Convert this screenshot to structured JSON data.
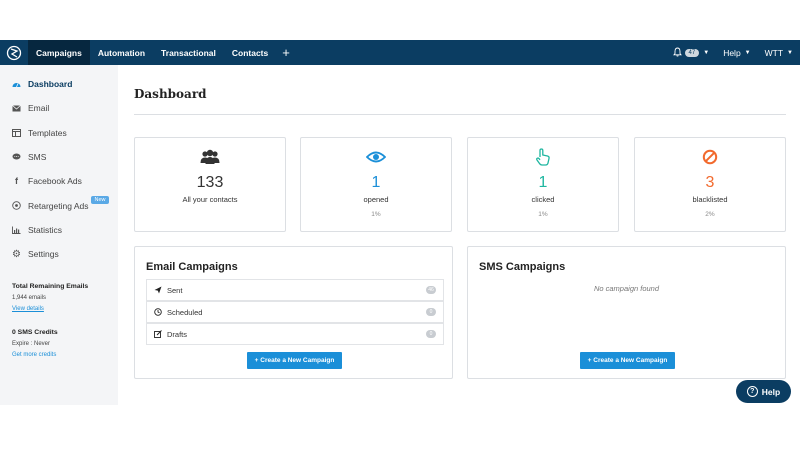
{
  "topnav": {
    "items": [
      "Campaigns",
      "Automation",
      "Transactional",
      "Contacts"
    ],
    "plus_label": "+",
    "notification_count": "47",
    "help_label": "Help",
    "account_label": "WTT"
  },
  "sidebar": {
    "items": [
      {
        "label": "Dashboard",
        "icon": "dashboard-icon"
      },
      {
        "label": "Email",
        "icon": "envelope-icon"
      },
      {
        "label": "Templates",
        "icon": "template-icon"
      },
      {
        "label": "SMS",
        "icon": "sms-bubble-icon"
      },
      {
        "label": "Facebook Ads",
        "icon": "facebook-icon"
      },
      {
        "label": "Retargeting Ads",
        "icon": "target-icon",
        "tag": "New"
      },
      {
        "label": "Statistics",
        "icon": "bar-chart-icon"
      },
      {
        "label": "Settings",
        "icon": "gear-icon"
      }
    ],
    "emails_block": {
      "title": "Total Remaining Emails",
      "count": "1,944 emails",
      "link": "View details"
    },
    "sms_block": {
      "title": "0 SMS Credits",
      "expire": "Expire : Never",
      "link": "Get more credits"
    }
  },
  "main": {
    "title": "Dashboard",
    "stats": [
      {
        "value": "133",
        "label": "All your contacts",
        "pct": "",
        "icon": "users-icon",
        "color": "#333333"
      },
      {
        "value": "1",
        "label": "opened",
        "pct": "1%",
        "icon": "eye-icon",
        "color": "#1b8fd8"
      },
      {
        "value": "1",
        "label": "clicked",
        "pct": "1%",
        "icon": "pointer-hand-icon",
        "color": "#1fb6a0"
      },
      {
        "value": "3",
        "label": "blacklisted",
        "pct": "2%",
        "icon": "ban-icon",
        "color": "#f26a2e"
      }
    ],
    "email_campaigns": {
      "title": "Email Campaigns",
      "rows": [
        {
          "label": "Sent",
          "count": "46",
          "icon": "send-icon"
        },
        {
          "label": "Scheduled",
          "count": "0",
          "icon": "clock-icon"
        },
        {
          "label": "Drafts",
          "count": "0",
          "icon": "edit-icon"
        }
      ],
      "button": "+ Create a New Campaign"
    },
    "sms_campaigns": {
      "title": "SMS Campaigns",
      "empty": "No campaign found",
      "button": "+ Create a New Campaign"
    },
    "help_button": "Help"
  },
  "colors": {
    "nav_bg": "#0b3d62",
    "accent": "#1b8fd8",
    "sidebar_bg": "#f4f5f7"
  }
}
